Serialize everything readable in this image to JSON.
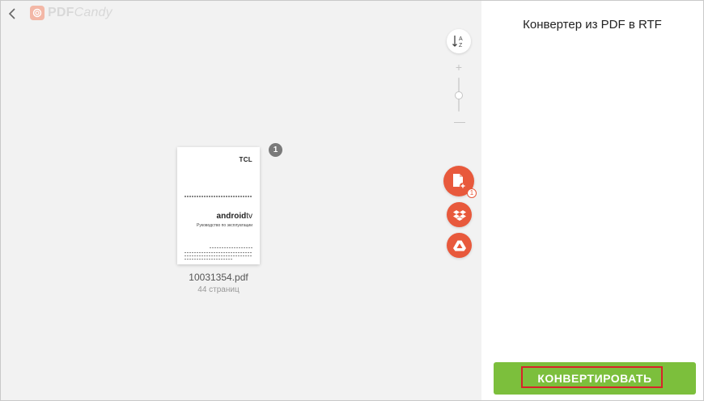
{
  "brand": {
    "name_main": "PDF",
    "name_italic": "Candy",
    "accent": "#e8593c"
  },
  "toolbar": {
    "back_icon": "chevron-left-icon",
    "sort_icon": "sort-a-z-icon",
    "zoom_plus": "+",
    "zoom_minus": "—",
    "zoom_level": 0.5
  },
  "side_actions": [
    {
      "name": "add-file",
      "icon": "file-plus-icon",
      "badge": "1"
    },
    {
      "name": "dropbox",
      "icon": "dropbox-icon"
    },
    {
      "name": "google-drive",
      "icon": "google-drive-icon"
    }
  ],
  "file": {
    "index": "1",
    "name": "10031354.pdf",
    "pages": "44 страниц",
    "thumb": {
      "brand": "TCL",
      "title_bold": "android",
      "title_light": "tv",
      "subtitle": "Руководство по эксплуатации"
    }
  },
  "panel": {
    "title": "Конвертер из PDF в RTF",
    "convert_label": "КОНВЕРТИРОВАТЬ",
    "convert_color": "#7cbf3c",
    "highlight_color": "#d8232a"
  }
}
